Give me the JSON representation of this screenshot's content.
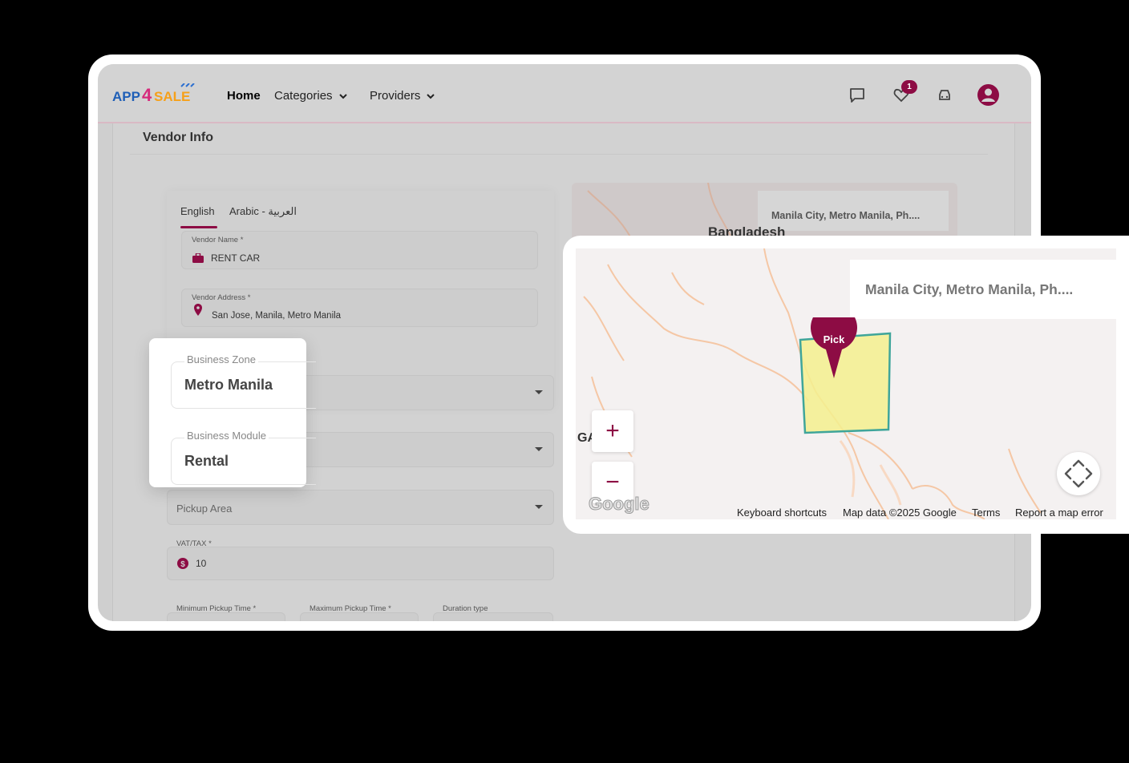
{
  "navbar": {
    "logo_text": "APP4SALE",
    "home": "Home",
    "categories": "Categories",
    "providers": "Providers",
    "wishlist_count": "1"
  },
  "page": {
    "section_title": "Vendor Info"
  },
  "tabs": [
    {
      "label": "English"
    },
    {
      "label": "Arabic - العربية"
    }
  ],
  "form": {
    "vendor_name_label": "Vendor Name *",
    "vendor_name_value": "RENT CAR",
    "vendor_address_label": "Vendor Address *",
    "vendor_address_value": "San Jose, Manila, Metro Manila",
    "pickup_area_placeholder": "Pickup Area",
    "vat_label": "VAT/TAX *",
    "vat_value": "10",
    "min_pickup_label": "Minimum Pickup Time *",
    "max_pickup_label": "Maximum Pickup Time *",
    "duration_label": "Duration type"
  },
  "popup": {
    "business_zone_label": "Business Zone",
    "business_zone_value": "Metro Manila",
    "business_module_label": "Business Module",
    "business_module_value": "Rental"
  },
  "map": {
    "search_text": "Manila City, Metro Manila, Ph....",
    "bg_search_text": "Manila City, Metro Manila, Ph....",
    "bg_place_label": "Bangladesh",
    "place_label_partial": "GA",
    "pin_label": "Pick",
    "zoom_in": "+",
    "zoom_out": "−",
    "google": "Google",
    "footer": {
      "shortcuts": "Keyboard shortcuts",
      "data": "Map data ©2025 Google",
      "terms": "Terms",
      "report": "Report a map error"
    }
  },
  "colors": {
    "accent": "#8d0c44",
    "zone_fill": "#f3f08e",
    "zone_stroke": "#3fa59a"
  }
}
